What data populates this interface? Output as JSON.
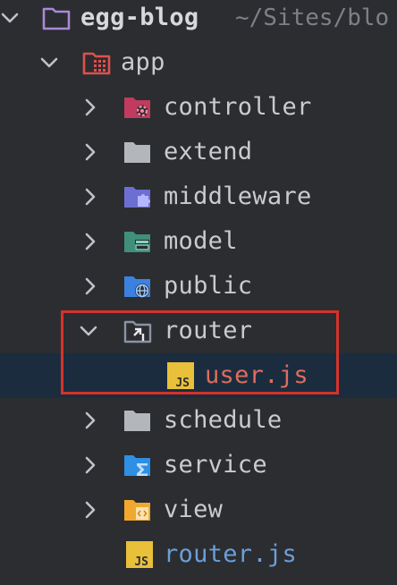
{
  "project": {
    "name": "egg-blog",
    "path": "~/Sites/blo"
  },
  "app": {
    "label": "app"
  },
  "folders": [
    {
      "label": "controller",
      "icon": "folder-controller-icon"
    },
    {
      "label": "extend",
      "icon": "folder-icon"
    },
    {
      "label": "middleware",
      "icon": "folder-middleware-icon"
    },
    {
      "label": "model",
      "icon": "folder-model-icon"
    },
    {
      "label": "public",
      "icon": "folder-public-icon"
    },
    {
      "label": "router",
      "icon": "folder-router-icon"
    },
    {
      "label": "user.js",
      "icon": "js-file-icon"
    },
    {
      "label": "schedule",
      "icon": "folder-icon"
    },
    {
      "label": "service",
      "icon": "folder-service-icon"
    },
    {
      "label": "view",
      "icon": "folder-view-icon"
    },
    {
      "label": "router.js",
      "icon": "js-file-icon"
    }
  ],
  "colors": {
    "background": "#2b2d31",
    "selection": "#1b2c3f",
    "highlight_box": "#d6332b",
    "modified_file": "#e06c5a",
    "file_blue": "#6a9fd8"
  }
}
